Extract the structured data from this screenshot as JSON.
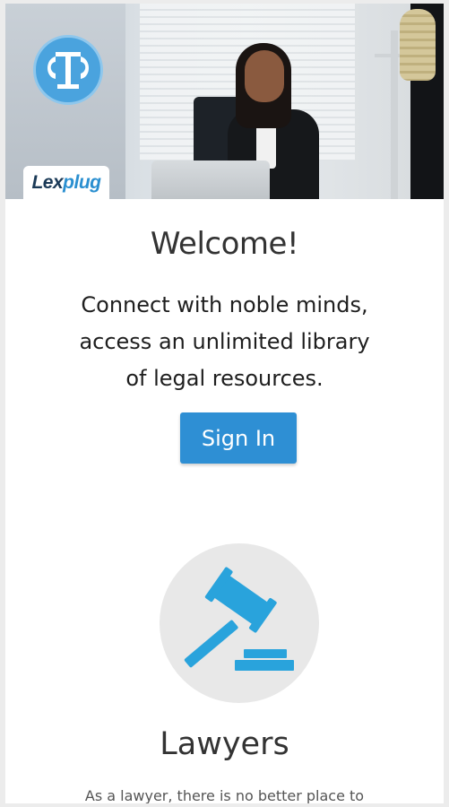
{
  "brand": {
    "name_part1": "Lex",
    "name_part2": "plug",
    "logo_icon": "scales-of-justice-icon",
    "colors": {
      "primary": "#2e8fd4",
      "dark": "#1b3a57"
    }
  },
  "hero": {
    "image": "woman-at-desk-office-photo"
  },
  "welcome": {
    "title": "Welcome!",
    "tagline_line1": "Connect with noble minds,",
    "tagline_line2": "access an unlimited library",
    "tagline_line3": "of legal resources.",
    "signin_label": "Sign In"
  },
  "lawyers": {
    "icon": "gavel-icon",
    "title": "Lawyers",
    "description": "As a lawyer, there is no better place to"
  }
}
